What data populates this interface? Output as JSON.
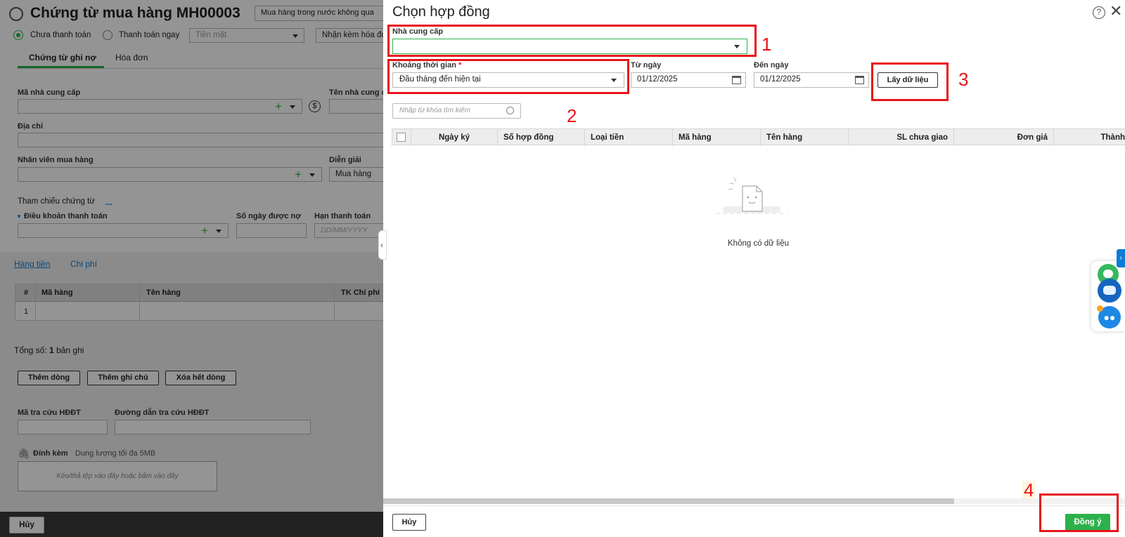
{
  "background": {
    "title": "Chứng từ mua hàng MH00003",
    "type_select": "Mua hàng trong nước không qua",
    "radio_unpaid": "Chưa thanh toán",
    "radio_paid": "Thanh toán ngay",
    "payment_method": "Tiền mặt",
    "invoice_select": "Nhận kèm hóa đơ",
    "tabs": [
      "Chứng từ ghi nợ",
      "Hóa đơn"
    ],
    "supplier_code_label": "Mã nhà cung cấp",
    "supplier_name_label": "Tên nhà cung c",
    "address_label": "Địa chỉ",
    "buyer_label": "Nhân viên mua hàng",
    "description_label": "Diễn giải",
    "description_value": "Mua hàng",
    "reference_label": "Tham chiếu chứng từ",
    "reference_more": "...",
    "payment_terms_label": "Điều khoản thanh toán",
    "credit_days_label": "Số ngày được nợ",
    "due_date_label": "Hạn thanh toán",
    "due_date_placeholder": "DD/MM/YYYY",
    "detail_tabs": [
      "Hàng tiền",
      "Chi phí"
    ],
    "grid_headers": [
      "#",
      "Mã hàng",
      "Tên hàng",
      "TK Chi phí"
    ],
    "grid_row_no": "1",
    "total_label": "Tổng số:",
    "total_count": "1",
    "total_unit": "bản ghi",
    "add_row": "Thêm dòng",
    "add_note": "Thêm ghi chú",
    "delete_all": "Xóa hết dòng",
    "lookup_code_label": "Mã tra cứu HĐĐT",
    "lookup_url_label": "Đường dẫn tra cứu HĐĐT",
    "attach_label": "Đính kèm",
    "attach_limit": "Dung lượng tối đa 5MB",
    "drop_text": "Kéo/thả tệp vào đây hoặc bấm vào đây",
    "cancel": "Hủy"
  },
  "dialog": {
    "title": "Chọn hợp đồng",
    "supplier_label": "Nhà cung cấp",
    "supplier_value": "",
    "period_label": "Khoảng thời gian",
    "required_mark": "*",
    "period_value": "Đầu tháng đến hiện tại",
    "from_label": "Từ ngày",
    "from_value": "01/12/2025",
    "to_label": "Đến ngày",
    "to_value": "01/12/2025",
    "fetch_button": "Lấy dữ liệu",
    "search_placeholder": "Nhập từ khóa tìm kiếm",
    "columns": [
      "Ngày ký",
      "Số hợp đồng",
      "Loại tiền",
      "Mã hàng",
      "Tên hàng",
      "SL chưa giao",
      "Đơn giá",
      "Thành"
    ],
    "empty_text": "Không có dữ liệu",
    "cancel_button": "Hủy",
    "ok_button": "Đồng ý"
  },
  "annotations": [
    "1",
    "2",
    "3",
    "4"
  ],
  "colors": {
    "accent_green": "#2db14b",
    "annotation_red": "#e8141b",
    "help_blue": "#0b7bd6"
  }
}
